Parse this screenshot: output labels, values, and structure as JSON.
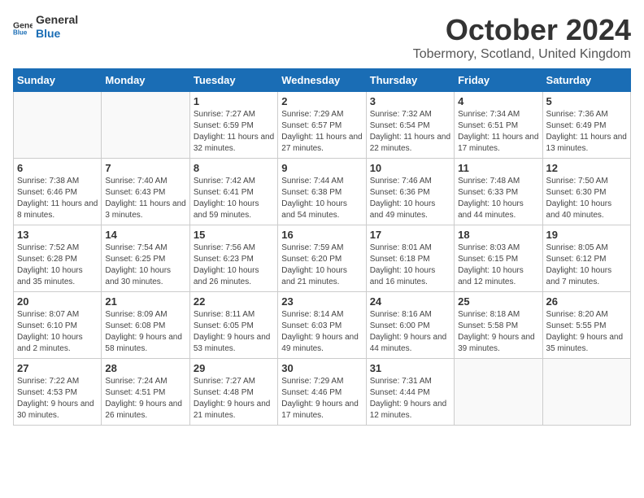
{
  "header": {
    "logo_general": "General",
    "logo_blue": "Blue",
    "month_title": "October 2024",
    "location": "Tobermory, Scotland, United Kingdom"
  },
  "weekdays": [
    "Sunday",
    "Monday",
    "Tuesday",
    "Wednesday",
    "Thursday",
    "Friday",
    "Saturday"
  ],
  "weeks": [
    [
      {
        "day": "",
        "info": ""
      },
      {
        "day": "",
        "info": ""
      },
      {
        "day": "1",
        "info": "Sunrise: 7:27 AM\nSunset: 6:59 PM\nDaylight: 11 hours and 32 minutes."
      },
      {
        "day": "2",
        "info": "Sunrise: 7:29 AM\nSunset: 6:57 PM\nDaylight: 11 hours and 27 minutes."
      },
      {
        "day": "3",
        "info": "Sunrise: 7:32 AM\nSunset: 6:54 PM\nDaylight: 11 hours and 22 minutes."
      },
      {
        "day": "4",
        "info": "Sunrise: 7:34 AM\nSunset: 6:51 PM\nDaylight: 11 hours and 17 minutes."
      },
      {
        "day": "5",
        "info": "Sunrise: 7:36 AM\nSunset: 6:49 PM\nDaylight: 11 hours and 13 minutes."
      }
    ],
    [
      {
        "day": "6",
        "info": "Sunrise: 7:38 AM\nSunset: 6:46 PM\nDaylight: 11 hours and 8 minutes."
      },
      {
        "day": "7",
        "info": "Sunrise: 7:40 AM\nSunset: 6:43 PM\nDaylight: 11 hours and 3 minutes."
      },
      {
        "day": "8",
        "info": "Sunrise: 7:42 AM\nSunset: 6:41 PM\nDaylight: 10 hours and 59 minutes."
      },
      {
        "day": "9",
        "info": "Sunrise: 7:44 AM\nSunset: 6:38 PM\nDaylight: 10 hours and 54 minutes."
      },
      {
        "day": "10",
        "info": "Sunrise: 7:46 AM\nSunset: 6:36 PM\nDaylight: 10 hours and 49 minutes."
      },
      {
        "day": "11",
        "info": "Sunrise: 7:48 AM\nSunset: 6:33 PM\nDaylight: 10 hours and 44 minutes."
      },
      {
        "day": "12",
        "info": "Sunrise: 7:50 AM\nSunset: 6:30 PM\nDaylight: 10 hours and 40 minutes."
      }
    ],
    [
      {
        "day": "13",
        "info": "Sunrise: 7:52 AM\nSunset: 6:28 PM\nDaylight: 10 hours and 35 minutes."
      },
      {
        "day": "14",
        "info": "Sunrise: 7:54 AM\nSunset: 6:25 PM\nDaylight: 10 hours and 30 minutes."
      },
      {
        "day": "15",
        "info": "Sunrise: 7:56 AM\nSunset: 6:23 PM\nDaylight: 10 hours and 26 minutes."
      },
      {
        "day": "16",
        "info": "Sunrise: 7:59 AM\nSunset: 6:20 PM\nDaylight: 10 hours and 21 minutes."
      },
      {
        "day": "17",
        "info": "Sunrise: 8:01 AM\nSunset: 6:18 PM\nDaylight: 10 hours and 16 minutes."
      },
      {
        "day": "18",
        "info": "Sunrise: 8:03 AM\nSunset: 6:15 PM\nDaylight: 10 hours and 12 minutes."
      },
      {
        "day": "19",
        "info": "Sunrise: 8:05 AM\nSunset: 6:12 PM\nDaylight: 10 hours and 7 minutes."
      }
    ],
    [
      {
        "day": "20",
        "info": "Sunrise: 8:07 AM\nSunset: 6:10 PM\nDaylight: 10 hours and 2 minutes."
      },
      {
        "day": "21",
        "info": "Sunrise: 8:09 AM\nSunset: 6:08 PM\nDaylight: 9 hours and 58 minutes."
      },
      {
        "day": "22",
        "info": "Sunrise: 8:11 AM\nSunset: 6:05 PM\nDaylight: 9 hours and 53 minutes."
      },
      {
        "day": "23",
        "info": "Sunrise: 8:14 AM\nSunset: 6:03 PM\nDaylight: 9 hours and 49 minutes."
      },
      {
        "day": "24",
        "info": "Sunrise: 8:16 AM\nSunset: 6:00 PM\nDaylight: 9 hours and 44 minutes."
      },
      {
        "day": "25",
        "info": "Sunrise: 8:18 AM\nSunset: 5:58 PM\nDaylight: 9 hours and 39 minutes."
      },
      {
        "day": "26",
        "info": "Sunrise: 8:20 AM\nSunset: 5:55 PM\nDaylight: 9 hours and 35 minutes."
      }
    ],
    [
      {
        "day": "27",
        "info": "Sunrise: 7:22 AM\nSunset: 4:53 PM\nDaylight: 9 hours and 30 minutes."
      },
      {
        "day": "28",
        "info": "Sunrise: 7:24 AM\nSunset: 4:51 PM\nDaylight: 9 hours and 26 minutes."
      },
      {
        "day": "29",
        "info": "Sunrise: 7:27 AM\nSunset: 4:48 PM\nDaylight: 9 hours and 21 minutes."
      },
      {
        "day": "30",
        "info": "Sunrise: 7:29 AM\nSunset: 4:46 PM\nDaylight: 9 hours and 17 minutes."
      },
      {
        "day": "31",
        "info": "Sunrise: 7:31 AM\nSunset: 4:44 PM\nDaylight: 9 hours and 12 minutes."
      },
      {
        "day": "",
        "info": ""
      },
      {
        "day": "",
        "info": ""
      }
    ]
  ]
}
